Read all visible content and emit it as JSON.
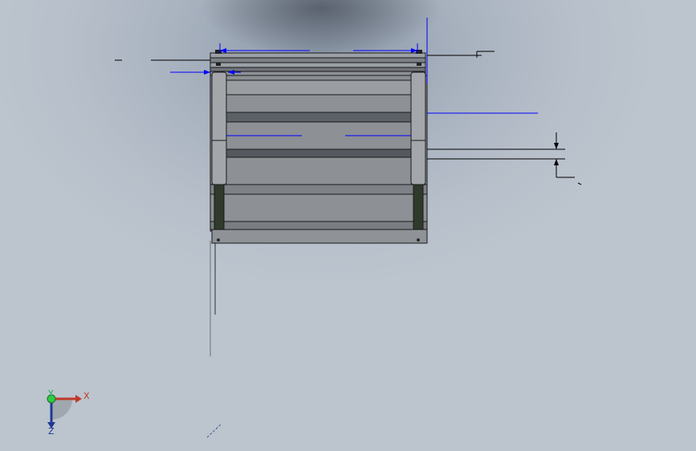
{
  "scene": {
    "view": "front",
    "background": "#b4bcc7",
    "model_fill": "#8a8d91",
    "model_fill_dark": "#4a4e55",
    "model_edge": "#1a1a1a",
    "dimension_color": "#0000ff",
    "annotation_color": "#000000"
  },
  "triad": {
    "x_label": "X",
    "y_label": "Y",
    "z_label": "Z",
    "x_color": "#c0392b",
    "y_color": "#27ae60",
    "z_color": "#1f3a93"
  },
  "icons": {
    "triad": "coordinate-triad-icon",
    "origin": "origin-sphere-icon"
  }
}
